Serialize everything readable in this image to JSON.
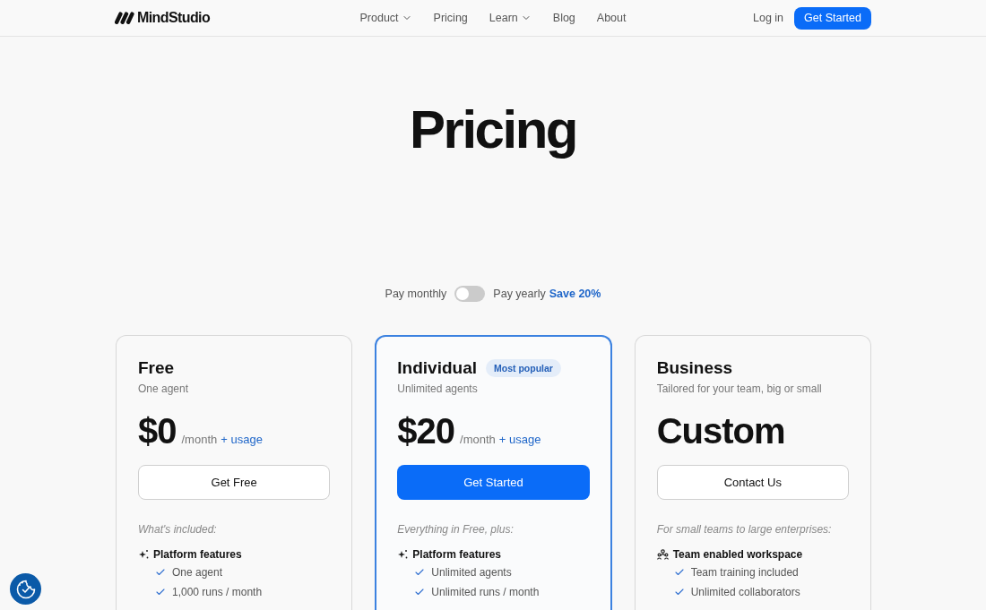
{
  "brand": {
    "name": "MindStudio"
  },
  "nav": {
    "items": [
      {
        "label": "Product",
        "dropdown": true
      },
      {
        "label": "Pricing",
        "dropdown": false
      },
      {
        "label": "Learn",
        "dropdown": true
      },
      {
        "label": "Blog",
        "dropdown": false
      },
      {
        "label": "About",
        "dropdown": false
      }
    ],
    "login": "Log in",
    "cta": "Get Started"
  },
  "hero": {
    "title": "Pricing"
  },
  "billing": {
    "monthly_label": "Pay monthly",
    "yearly_label": "Pay yearly",
    "discount": "Save 20%",
    "yearly": false
  },
  "plans": [
    {
      "name": "Free",
      "subtitle": "One agent",
      "price": "$0",
      "period": "/month",
      "usage": "+ usage",
      "button": "Get Free",
      "featured": false,
      "included_label": "What's included:",
      "feature_groups": [
        {
          "kind": "platform",
          "heading": "Platform features",
          "items": [
            "One agent",
            "1,000 runs / month"
          ]
        }
      ]
    },
    {
      "name": "Individual",
      "badge": "Most popular",
      "subtitle": "Unlimited agents",
      "price": "$20",
      "period": "/month",
      "usage": "+ usage",
      "button": "Get Started",
      "featured": true,
      "included_label": "Everything in Free, plus:",
      "feature_groups": [
        {
          "kind": "platform",
          "heading": "Platform features",
          "items": [
            "Unlimited agents",
            "Unlimited runs / month"
          ]
        }
      ]
    },
    {
      "name": "Business",
      "subtitle": "Tailored for your team, big or small",
      "price": "Custom",
      "button": "Contact Us",
      "featured": false,
      "included_label": "For small teams to large enterprises:",
      "feature_groups": [
        {
          "kind": "team",
          "heading": "Team enabled workspace",
          "items": [
            "Team training included",
            "Unlimited collaborators"
          ]
        }
      ]
    }
  ]
}
